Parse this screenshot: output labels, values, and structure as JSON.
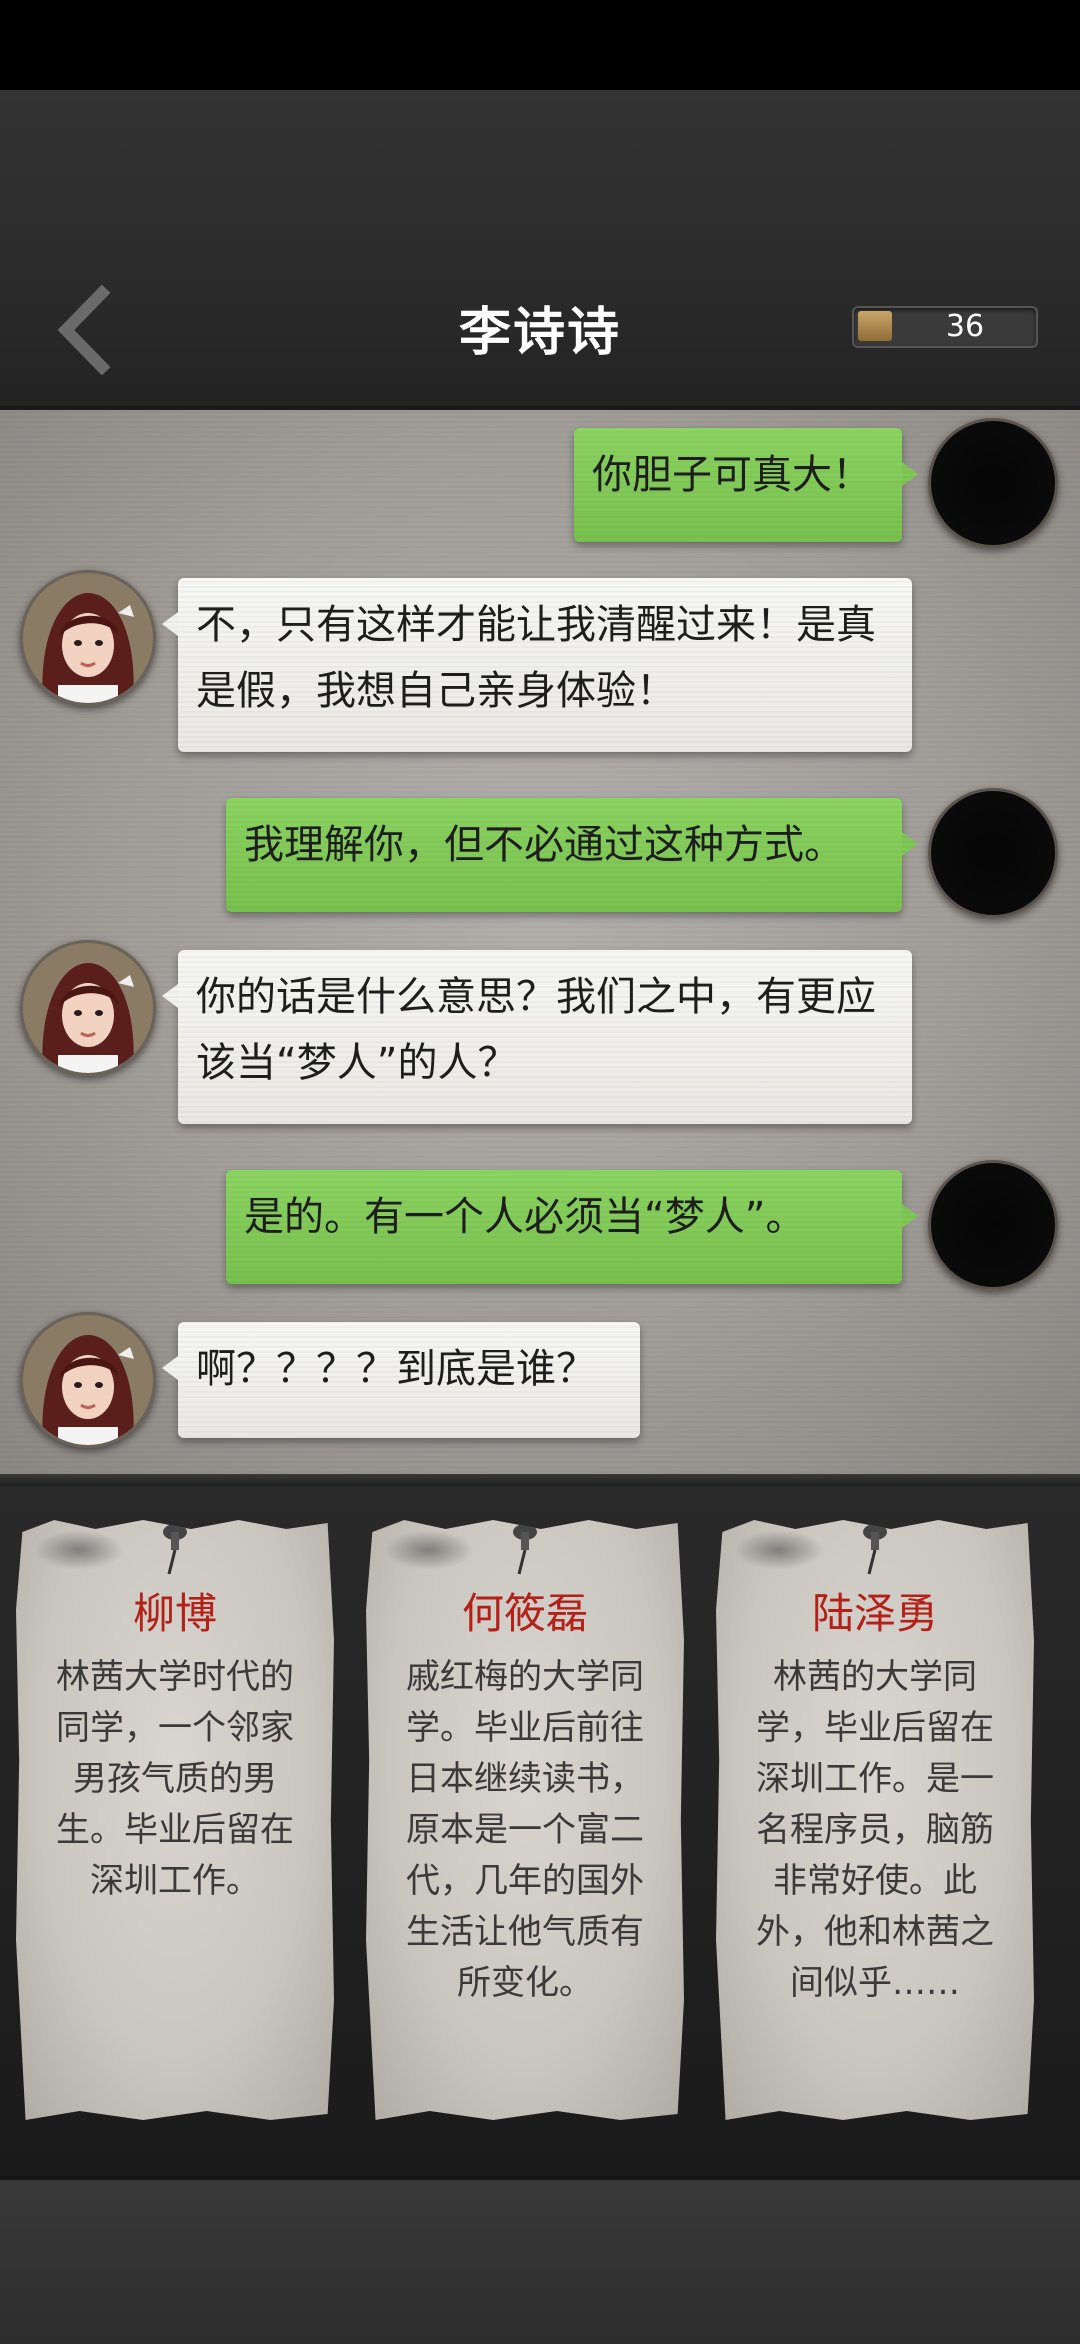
{
  "header": {
    "title": "李诗诗",
    "coins": "36"
  },
  "messages": [
    {
      "side": "player",
      "text": "你胆子可真大！"
    },
    {
      "side": "npc",
      "text": "不，只有这样才能让我清醒过来！是真是假，我想自己亲身体验！"
    },
    {
      "side": "player",
      "text": "我理解你，但不必通过这种方式。"
    },
    {
      "side": "npc",
      "text": "你的话是什么意思？我们之中，有更应该当“梦人”的人？"
    },
    {
      "side": "player",
      "text": "是的。有一个人必须当“梦人”。"
    },
    {
      "side": "npc",
      "text": "啊？？？？到底是谁？"
    }
  ],
  "cards": [
    {
      "name": "柳博",
      "desc": "林茜大学时代的同学，一个邻家男孩气质的男生。毕业后留在深圳工作。"
    },
    {
      "name": "何筱磊",
      "desc": "戚红梅的大学同学。毕业后前往日本继续读书，原本是一个富二代，几年的国外生活让他气质有所变化。"
    },
    {
      "name": "陆泽勇",
      "desc": "林茜的大学同学，毕业后留在深圳工作。是一名程序员，脑筋非常好使。此外，他和林茜之间似乎……"
    }
  ],
  "icons": {
    "back": "chevron-left-icon",
    "coin": "coin-icon",
    "pin": "pushpin-icon"
  },
  "colors": {
    "player_bubble": "#7fc656",
    "npc_bubble": "#f1f1ef",
    "card_name": "#b52016"
  }
}
